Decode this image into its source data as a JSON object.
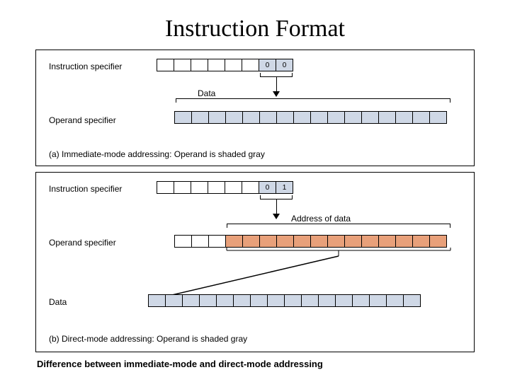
{
  "title": "Instruction Format",
  "panel_a": {
    "instruction_specifier_label": "Instruction specifier",
    "operand_specifier_label": "Operand specifier",
    "data_label": "Data",
    "caption": "(a) Immediate-mode addressing: Operand is shaded gray",
    "instr_bits": [
      "",
      "",
      "",
      "",
      "",
      "",
      "0",
      "0"
    ],
    "operand_count": 16
  },
  "panel_b": {
    "instruction_specifier_label": "Instruction specifier",
    "operand_specifier_label": "Operand specifier",
    "data_label": "Data",
    "address_label": "Address of data",
    "caption": "(b) Direct-mode addressing: Operand is shaded gray",
    "instr_bits": [
      "",
      "",
      "",
      "",
      "",
      "",
      "0",
      "1"
    ],
    "operand_white": 3,
    "operand_orange": 13,
    "data_count": 16
  },
  "bottom_caption": "Difference between immediate-mode and direct-mode addressing"
}
